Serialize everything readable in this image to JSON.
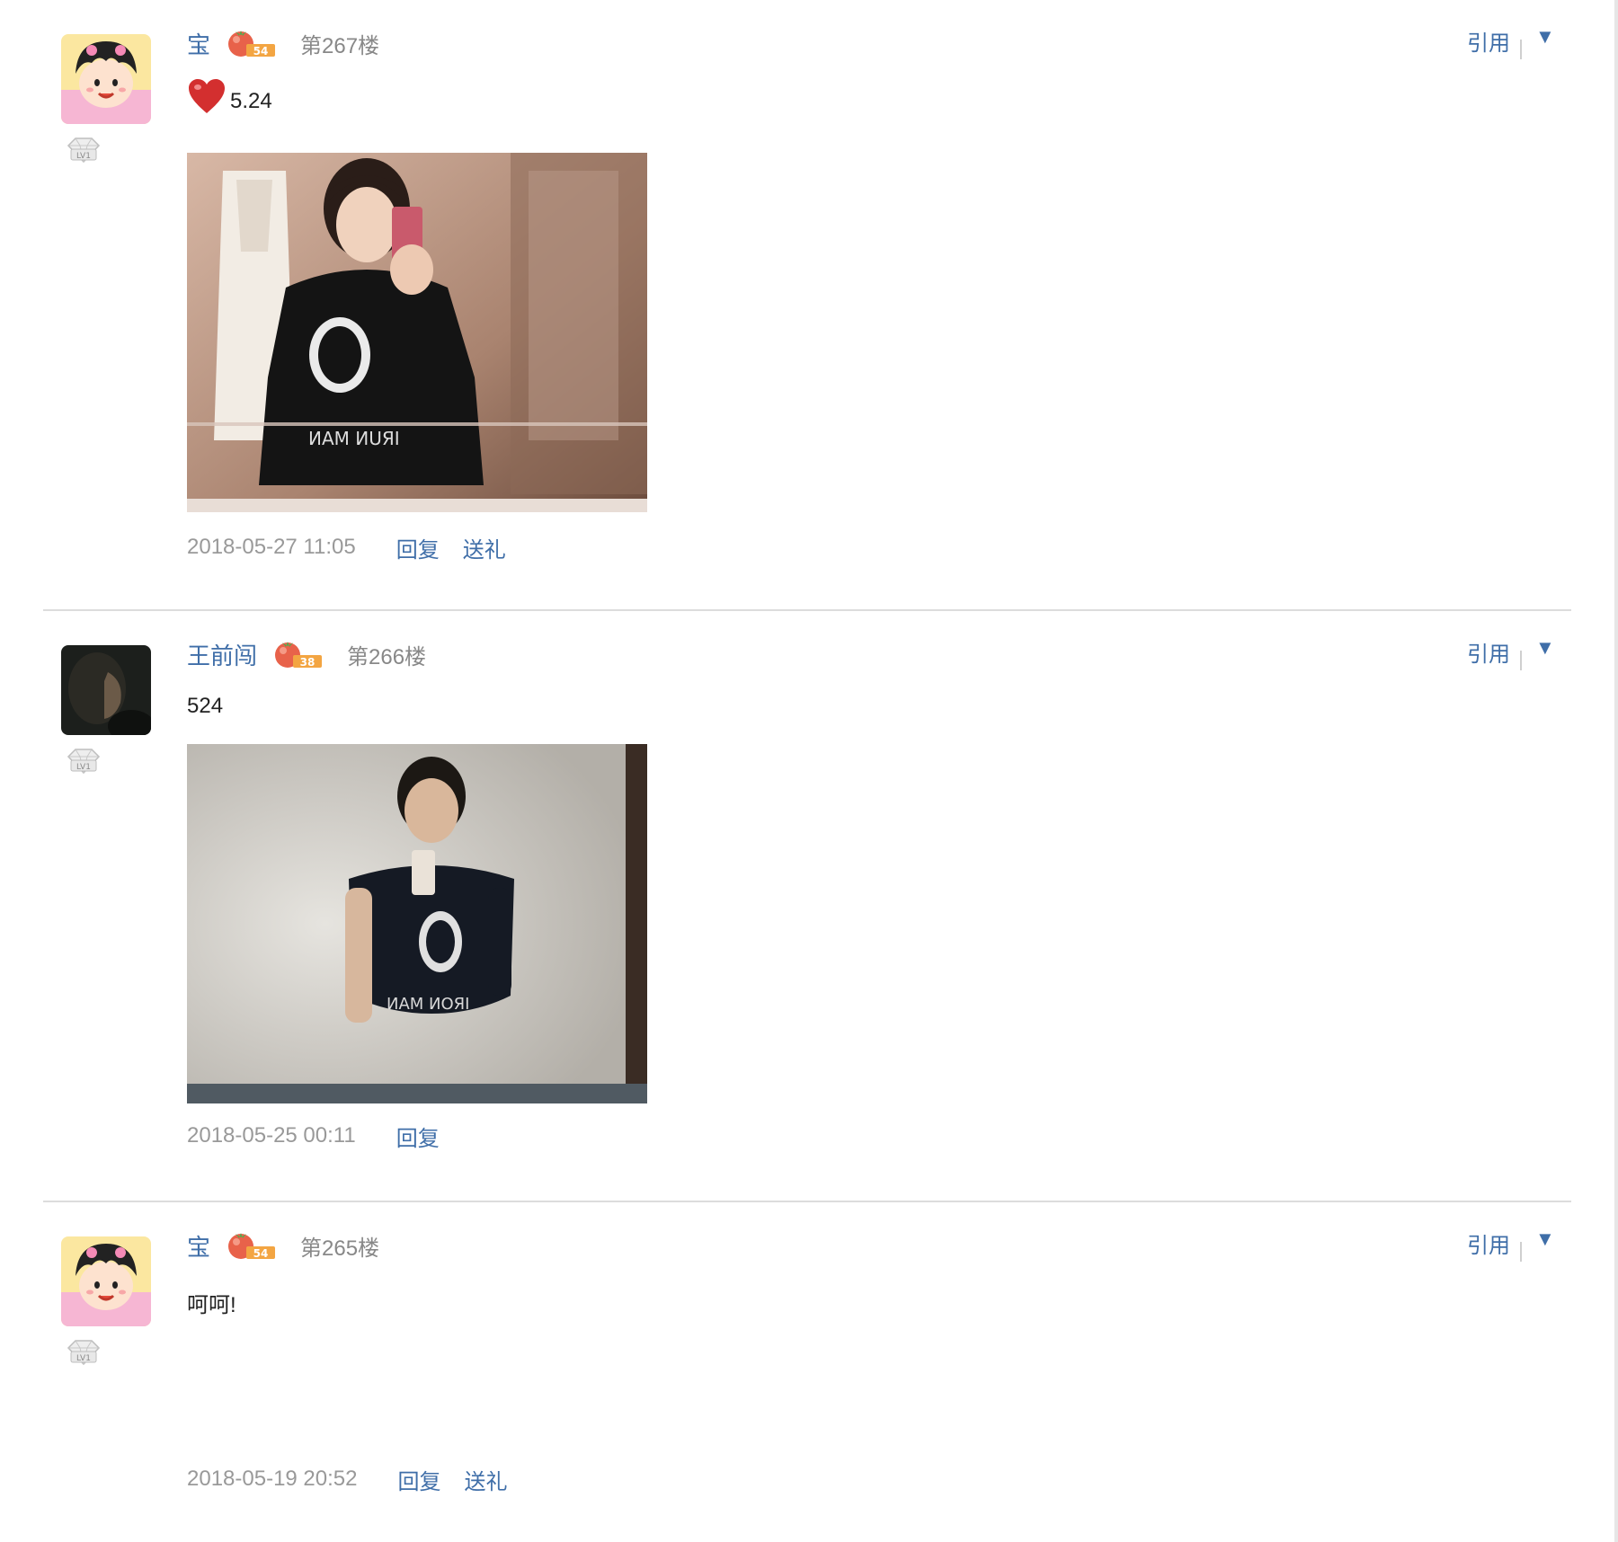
{
  "posts": [
    {
      "username": "宝",
      "tomato_level": "54",
      "floor": "第267楼",
      "content_text": "5.24",
      "has_heart": true,
      "has_photo": true,
      "timestamp": "2018-05-27 11:05",
      "actions": [
        "回复",
        "送礼"
      ],
      "quote_label": "引用",
      "level_badge": "LV1",
      "avatar": "cartoon-girl-avatar"
    },
    {
      "username": "王前闯",
      "tomato_level": "38",
      "floor": "第266楼",
      "content_text": "524",
      "has_heart": false,
      "has_photo": true,
      "timestamp": "2018-05-25 00:11",
      "actions": [
        "回复"
      ],
      "quote_label": "引用",
      "level_badge": "LV1",
      "avatar": "dark-portrait-avatar"
    },
    {
      "username": "宝",
      "tomato_level": "54",
      "floor": "第265楼",
      "content_text": "呵呵!",
      "has_heart": false,
      "has_photo": false,
      "timestamp": "2018-05-19 20:52",
      "actions": [
        "回复",
        "送礼"
      ],
      "quote_label": "引用",
      "level_badge": "LV1",
      "avatar": "cartoon-girl-avatar"
    }
  ],
  "icons": {
    "more": "▼",
    "heart": "heart-icon",
    "tomato": "tomato-badge-icon",
    "level": "diamond-level-icon"
  },
  "colors": {
    "link": "#3f6ea8",
    "muted": "#999999",
    "divider": "#dcdcdc"
  }
}
